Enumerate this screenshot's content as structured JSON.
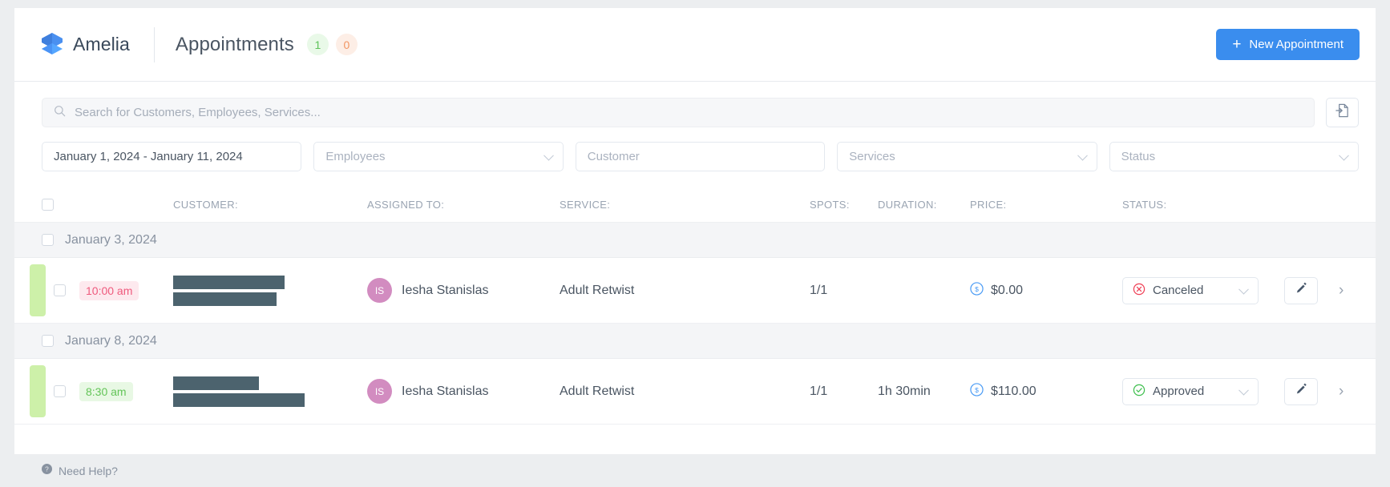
{
  "header": {
    "brand_name": "Amelia",
    "logo_icon": "amelia-cube-logo",
    "page_title": "Appointments",
    "badge_approved": "1",
    "badge_pending": "0",
    "new_appointment_label": "New Appointment",
    "plus_icon": "plus-icon",
    "accent_color": "#3a8dee",
    "badge_green": "#5ec35a",
    "badge_orange": "#f29563"
  },
  "search": {
    "placeholder": "Search for Customers, Employees, Services...",
    "value": "",
    "search_icon": "search-icon",
    "export_icon": "export-document-icon"
  },
  "filters": {
    "date_range": "January 1, 2024 - January 11, 2024",
    "employees_placeholder": "Employees",
    "customer_placeholder": "Customer",
    "services_placeholder": "Services",
    "status_placeholder": "Status"
  },
  "table": {
    "columns": [
      "CUSTOMER:",
      "ASSIGNED TO:",
      "SERVICE:",
      "SPOTS:",
      "DURATION:",
      "PRICE:",
      "STATUS:"
    ],
    "groups": [
      {
        "date": "January 3, 2024",
        "rows": [
          {
            "time": "10:00 am",
            "time_tone": "red",
            "customer": "",
            "customer_redacted": true,
            "assignee_initials": "IS",
            "assignee": "Iesha Stanislas",
            "service": "Adult Retwist",
            "spots": "1/1",
            "duration": "",
            "price": "$0.00",
            "status": "Canceled",
            "status_tone": "canceled"
          }
        ]
      },
      {
        "date": "January 8, 2024",
        "rows": [
          {
            "time": "8:30 am",
            "time_tone": "green",
            "customer": "",
            "customer_redacted": true,
            "assignee_initials": "IS",
            "assignee": "Iesha Stanislas",
            "service": "Adult Retwist",
            "spots": "1/1",
            "duration": "1h 30min",
            "price": "$110.00",
            "status": "Approved",
            "status_tone": "approved"
          }
        ]
      }
    ]
  },
  "footer": {
    "need_help": "Need Help?",
    "help_icon": "question-circle-icon"
  }
}
